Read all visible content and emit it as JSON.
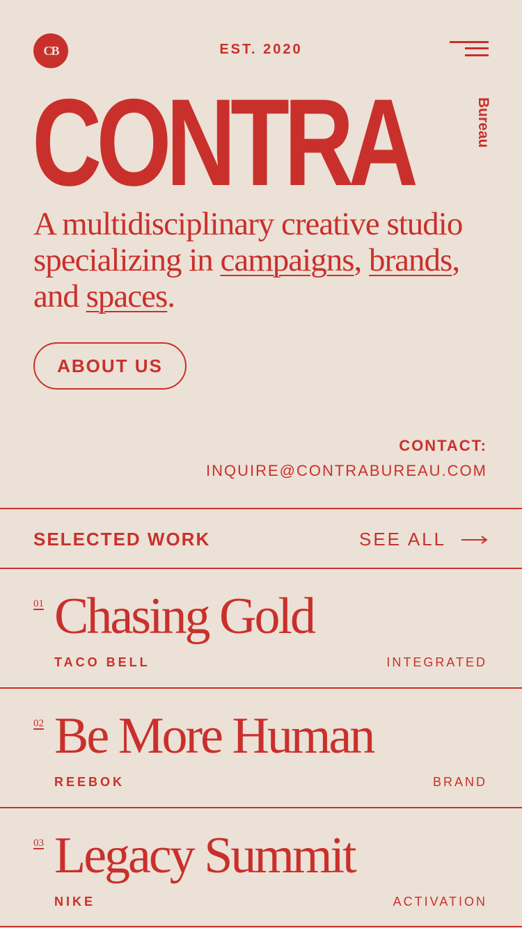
{
  "header": {
    "logo_monogram": "CB",
    "est_label": "EST. 2020",
    "menu_icon": "hamburger-menu-icon"
  },
  "hero": {
    "wordmark": "CONTRA",
    "wordmark_side": "Bureau",
    "tagline_intro": "A multidisciplinary creative studio specializing in ",
    "tagline_link_1": "campaigns",
    "tagline_sep_1": ",",
    "tagline_link_2": "brands",
    "tagline_sep_2": ", and ",
    "tagline_link_3": "spaces",
    "tagline_end": ".",
    "about_button": "ABOUT US"
  },
  "contact": {
    "label": "CONTACT:",
    "email": "INQUIRE@CONTRABUREAU.COM"
  },
  "work": {
    "heading": "SELECTED WORK",
    "see_all": "SEE ALL",
    "arrow_icon": "arrow-right-icon",
    "projects": [
      {
        "num": "01",
        "title": "Chasing Gold",
        "client": "TACO BELL",
        "category": "INTEGRATED"
      },
      {
        "num": "02",
        "title": "Be More Human",
        "client": "REEBOK",
        "category": "BRAND"
      },
      {
        "num": "03",
        "title": "Legacy Summit",
        "client": "NIKE",
        "category": "ACTIVATION"
      }
    ]
  },
  "colors": {
    "background": "#ece1d6",
    "accent": "#c9302c"
  }
}
